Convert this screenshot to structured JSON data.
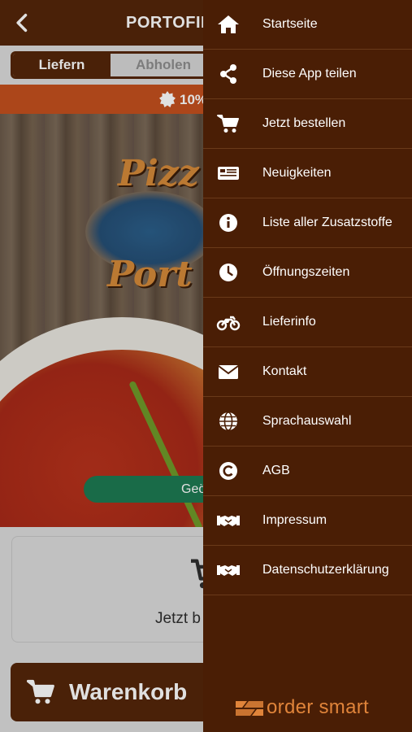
{
  "header": {
    "title": "PORTOFINO",
    "back_icon": "chevron-left-icon"
  },
  "segment": {
    "active": "Liefern",
    "inactive": "Abholen"
  },
  "promo": {
    "text": "10%",
    "icon": "badge-icon"
  },
  "hero": {
    "logo_line1": "Pizz",
    "logo_line2": "Port"
  },
  "order_pill": {
    "text": "Geö"
  },
  "order_card": {
    "text": "Jetzt b",
    "icon": "cart-icon"
  },
  "cart_bar": {
    "label": "Warenkorb",
    "icon": "cart-icon"
  },
  "menu": {
    "items": [
      {
        "label": "Startseite",
        "icon": "home-icon"
      },
      {
        "label": "Diese App teilen",
        "icon": "share-icon"
      },
      {
        "label": "Jetzt bestellen",
        "icon": "cart-icon"
      },
      {
        "label": "Neuigkeiten",
        "icon": "newspaper-icon"
      },
      {
        "label": "Liste aller Zusatzstoffe",
        "icon": "info-icon"
      },
      {
        "label": "Öffnungszeiten",
        "icon": "clock-icon"
      },
      {
        "label": "Lieferinfo",
        "icon": "motorcycle-icon"
      },
      {
        "label": "Kontakt",
        "icon": "envelope-icon"
      },
      {
        "label": "Sprachauswahl",
        "icon": "globe-icon"
      },
      {
        "label": "AGB",
        "icon": "copyright-icon"
      },
      {
        "label": "Impressum",
        "icon": "handshake-icon"
      },
      {
        "label": "Datenschutzerklärung",
        "icon": "handshake-icon"
      }
    ]
  },
  "brand": {
    "text": "order smart"
  },
  "colors": {
    "header": "#55260a",
    "drawer": "#4a1e05",
    "promo": "#c4501e",
    "pill": "#1d7a52",
    "brand": "#e0843a"
  }
}
